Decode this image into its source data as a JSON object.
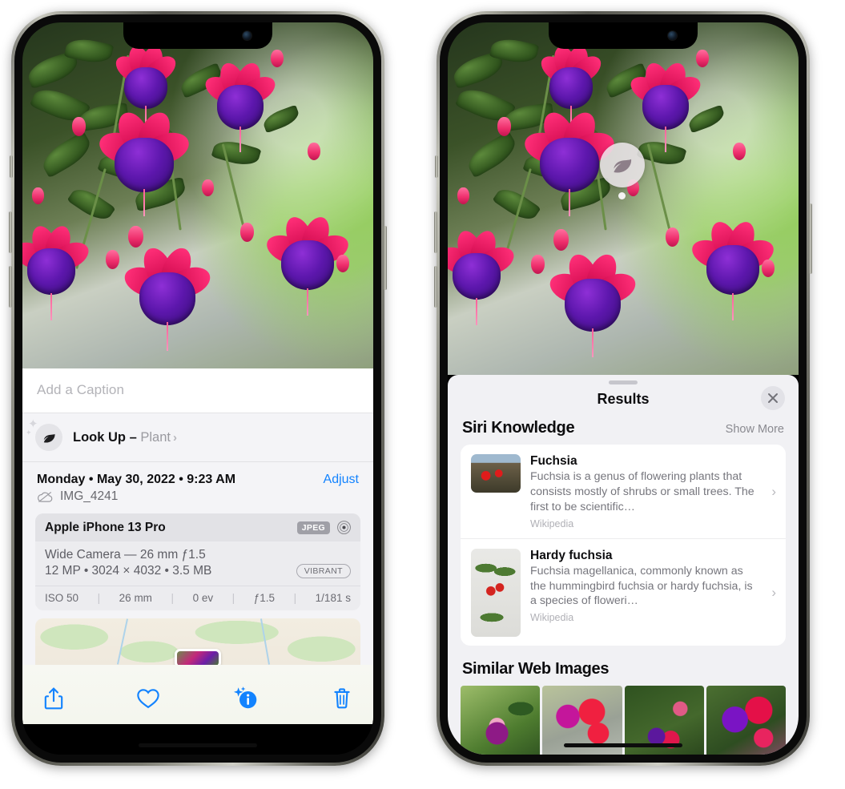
{
  "left_phone": {
    "photo": {
      "alt": "fuchsia-flowers-hanging-basket"
    },
    "caption_field": {
      "placeholder": "Add a Caption",
      "value": ""
    },
    "look_up": {
      "icon": "leaf-icon",
      "sparkle_icon": "sparkle-icon",
      "label": "Look Up – ",
      "subject": "Plant",
      "chevron": "›"
    },
    "meta": {
      "date": "Monday • May 30, 2022 • 9:23 AM",
      "adjust_label": "Adjust",
      "cloud_icon": "icloud-slash-icon",
      "filename": "IMG_4241"
    },
    "exif": {
      "device": "Apple iPhone 13 Pro",
      "format_badge": "JPEG",
      "aperture_icon": "aperture-icon",
      "lens_line": "Wide Camera — 26 mm ƒ1.5",
      "size_line": "12 MP • 3024 × 4032 • 3.5 MB",
      "style_badge": "VIBRANT",
      "stats": [
        "ISO 50",
        "26 mm",
        "0 ev",
        "ƒ1.5",
        "1/181 s"
      ],
      "stat_separator": "|"
    },
    "map": {
      "pin_label": "photo-location-pin"
    },
    "toolbar": [
      {
        "name": "share-icon",
        "label": "Share"
      },
      {
        "name": "heart-icon",
        "label": "Favorite"
      },
      {
        "name": "info-sparkle-icon",
        "label": "Info"
      },
      {
        "name": "trash-icon",
        "label": "Delete"
      }
    ],
    "toolbar_accent": "#1383fe"
  },
  "right_phone": {
    "photo": {
      "alt": "fuchsia-flowers-hanging-basket"
    },
    "lens_badge": {
      "icon": "leaf-icon",
      "label": "Visual Look Up"
    },
    "sheet": {
      "grabber": "drag-handle",
      "title": "Results",
      "close_icon": "close-icon"
    },
    "siri_knowledge": {
      "title": "Siri Knowledge",
      "action": "Show More",
      "items": [
        {
          "thumb": "fuchsia-red-flowers-thumb",
          "title": "Fuchsia",
          "description": "Fuchsia is a genus of flowering plants that consists mostly of shrubs or small trees. The first to be scientific…",
          "source": "Wikipedia",
          "chevron": "›"
        },
        {
          "thumb": "hardy-fuchsia-specimen-thumb",
          "title": "Hardy fuchsia",
          "description": "Fuchsia magellanica, commonly known as the hummingbird fuchsia or hardy fuchsia, is a species of floweri…",
          "source": "Wikipedia",
          "chevron": "›"
        }
      ]
    },
    "similar_web_images": {
      "title": "Similar Web Images",
      "images": [
        {
          "name": "web-image-1",
          "alt": "magenta fuchsia with green leaves"
        },
        {
          "name": "web-image-2",
          "alt": "red and pink fuchsia closeup"
        },
        {
          "name": "web-image-3",
          "alt": "fuchsia bush with many blooms"
        },
        {
          "name": "web-image-4",
          "alt": "purple and red fuchsia cluster"
        }
      ]
    }
  },
  "colors": {
    "accent_blue": "#1383fe",
    "sheet_bg": "#f1f1f4",
    "card_bg": "#ffffff",
    "secondary_text": "#76767d",
    "muted_text": "#b0b0b6"
  }
}
